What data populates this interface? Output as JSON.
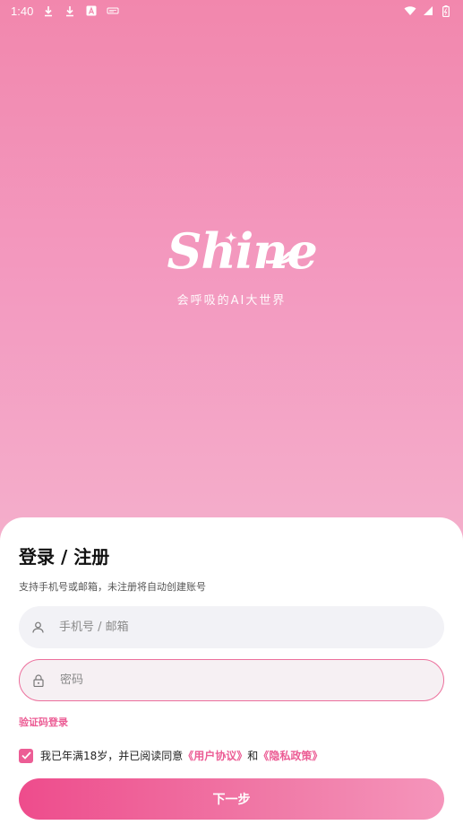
{
  "status_bar": {
    "time": "1:40",
    "icons": [
      "download-icon",
      "download-icon",
      "a-icon",
      "notification-icon"
    ],
    "right_icons": [
      "wifi-icon",
      "signal-icon",
      "battery-icon"
    ]
  },
  "brand": {
    "logo": "Shine",
    "tagline": "会呼吸的AI大世界"
  },
  "sheet": {
    "title": "登录 / 注册",
    "subtitle": "支持手机号或邮箱，未注册将自动创建账号",
    "phone_placeholder": "手机号 / 邮箱",
    "password_placeholder": "密码",
    "code_login": "验证码登录",
    "agree_text": "我已年满18岁，并已阅读同意",
    "user_agreement": "《用户协议》",
    "and": "和",
    "privacy_policy": "《隐私政策》",
    "next_button": "下一步"
  },
  "colors": {
    "accent": "#ec5d95",
    "background_top": "#f287ad",
    "background_bottom": "#f6c2d6"
  }
}
